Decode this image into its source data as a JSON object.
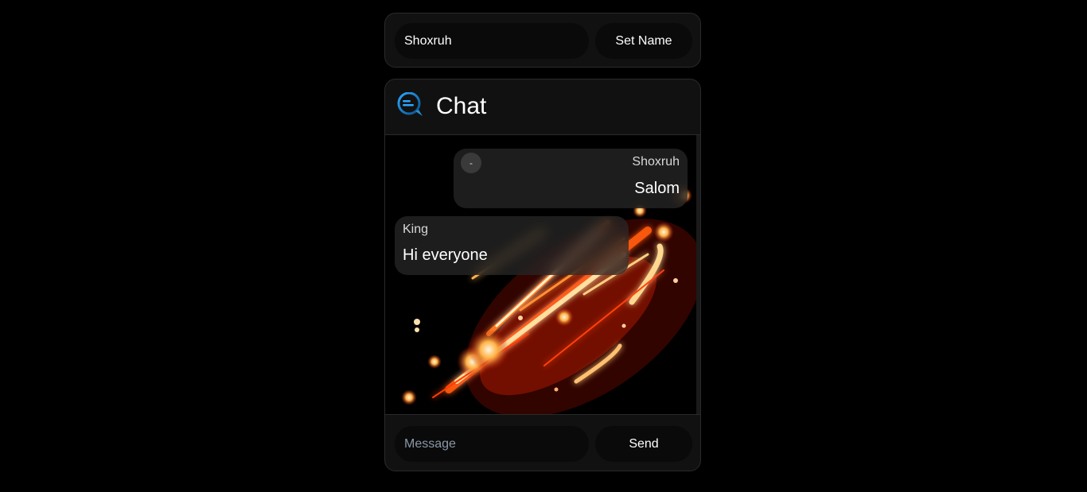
{
  "name_bar": {
    "name_value": "Shoxruh",
    "name_placeholder": "Name",
    "set_name_label": "Set Name"
  },
  "chat": {
    "title": "Chat",
    "icon": "chat-bubble-icon",
    "messages": [
      {
        "author": "Shoxruh",
        "text": "Salom",
        "mine": true,
        "delete_label": "-"
      },
      {
        "author": "King",
        "text": "Hi everyone",
        "mine": false
      }
    ]
  },
  "composer": {
    "message_value": "",
    "message_placeholder": "Message",
    "send_label": "Send"
  },
  "colors": {
    "background": "#000000",
    "card": "#111111",
    "pill": "#0a0a0a",
    "accent_icon": "#1e8fd6"
  }
}
